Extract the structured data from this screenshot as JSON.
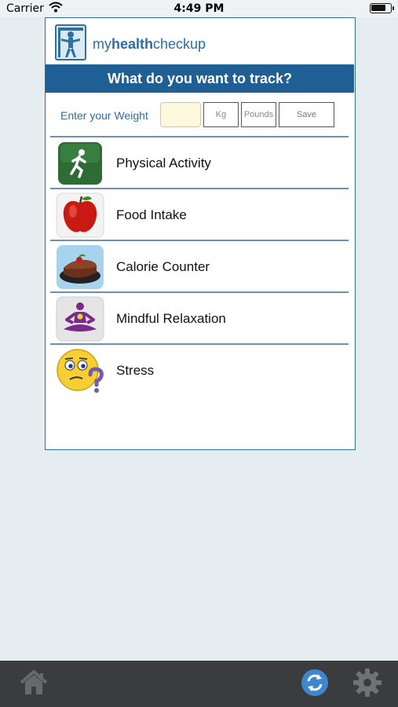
{
  "status_bar": {
    "carrier": "Carrier",
    "time": "4:49 PM",
    "battery_level": 0.8
  },
  "brand": {
    "prefix": "my",
    "bold": "health",
    "suffix": "checkup",
    "logo_icon": "body-figure-icon"
  },
  "banner": {
    "title": "What do you want to track?"
  },
  "weight": {
    "label": "Enter your Weight",
    "value": "",
    "kg_label": "Kg",
    "pounds_label": "Pounds",
    "save_label": "Save"
  },
  "track_items": [
    {
      "label": "Physical Activity",
      "icon": "running-person-icon"
    },
    {
      "label": "Food Intake",
      "icon": "apple-icon"
    },
    {
      "label": "Calorie Counter",
      "icon": "cake-icon"
    },
    {
      "label": "Mindful Relaxation",
      "icon": "meditation-icon"
    },
    {
      "label": "Stress",
      "icon": "worried-face-icon"
    }
  ],
  "tabbar": {
    "home_icon": "home-icon",
    "refresh_icon": "refresh-icon",
    "settings_icon": "gear-icon"
  },
  "colors": {
    "brand_blue": "#1f5f93",
    "text_blue": "#2d6da3",
    "divider": "#6f8fb3",
    "input_fill": "#fdf7dc",
    "tabbar": "#3a3c3e",
    "background": "#e6edf1"
  }
}
